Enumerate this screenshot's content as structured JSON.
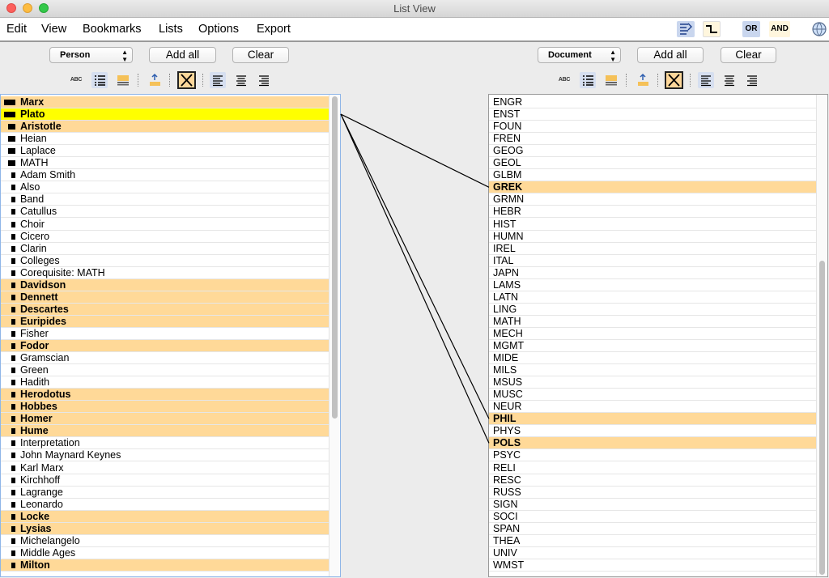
{
  "window": {
    "title": "List View"
  },
  "menu": [
    "Edit",
    "View",
    "Bookmarks",
    "Lists",
    "Options",
    "Export"
  ],
  "toolbar": {
    "or_label": "OR",
    "and_label": "AND",
    "icons": [
      "link-lines-icon",
      "step-icon",
      "or-toggle",
      "and-toggle",
      "globe-icon"
    ]
  },
  "left": {
    "type_select": "Person",
    "add_all": "Add all",
    "clear": "Clear",
    "abc": "ABC",
    "items": [
      {
        "label": "Marx",
        "state": "hl",
        "size": "big"
      },
      {
        "label": "Plato",
        "state": "sel",
        "size": "big"
      },
      {
        "label": "Aristotle",
        "state": "hl",
        "size": "med"
      },
      {
        "label": "Heian",
        "state": "",
        "size": "med"
      },
      {
        "label": "Laplace",
        "state": "",
        "size": "med"
      },
      {
        "label": "MATH",
        "state": "",
        "size": "med"
      },
      {
        "label": "Adam Smith",
        "state": "",
        "size": "small"
      },
      {
        "label": "Also",
        "state": "",
        "size": "small"
      },
      {
        "label": "Band",
        "state": "",
        "size": "small"
      },
      {
        "label": "Catullus",
        "state": "",
        "size": "small"
      },
      {
        "label": "Choir",
        "state": "",
        "size": "small"
      },
      {
        "label": "Cicero",
        "state": "",
        "size": "small"
      },
      {
        "label": "Clarin",
        "state": "",
        "size": "small"
      },
      {
        "label": "Colleges",
        "state": "",
        "size": "small"
      },
      {
        "label": "Corequisite: MATH",
        "state": "",
        "size": "small"
      },
      {
        "label": "Davidson",
        "state": "hl",
        "size": "small"
      },
      {
        "label": "Dennett",
        "state": "hl",
        "size": "small"
      },
      {
        "label": "Descartes",
        "state": "hl",
        "size": "small"
      },
      {
        "label": "Euripides",
        "state": "hl",
        "size": "small"
      },
      {
        "label": "Fisher",
        "state": "",
        "size": "small"
      },
      {
        "label": "Fodor",
        "state": "hl",
        "size": "small"
      },
      {
        "label": "Gramscian",
        "state": "",
        "size": "small"
      },
      {
        "label": "Green",
        "state": "",
        "size": "small"
      },
      {
        "label": "Hadith",
        "state": "",
        "size": "small"
      },
      {
        "label": "Herodotus",
        "state": "hl",
        "size": "small"
      },
      {
        "label": "Hobbes",
        "state": "hl",
        "size": "small"
      },
      {
        "label": "Homer",
        "state": "hl",
        "size": "small"
      },
      {
        "label": "Hume",
        "state": "hl",
        "size": "small"
      },
      {
        "label": "Interpretation",
        "state": "",
        "size": "small"
      },
      {
        "label": "John Maynard Keynes",
        "state": "",
        "size": "small"
      },
      {
        "label": "Karl Marx",
        "state": "",
        "size": "small"
      },
      {
        "label": "Kirchhoff",
        "state": "",
        "size": "small"
      },
      {
        "label": "Lagrange",
        "state": "",
        "size": "small"
      },
      {
        "label": "Leonardo",
        "state": "",
        "size": "small"
      },
      {
        "label": "Locke",
        "state": "hl",
        "size": "small"
      },
      {
        "label": "Lysias",
        "state": "hl",
        "size": "small"
      },
      {
        "label": "Michelangelo",
        "state": "",
        "size": "small"
      },
      {
        "label": "Middle Ages",
        "state": "",
        "size": "small"
      },
      {
        "label": "Milton",
        "state": "hl",
        "size": "small"
      }
    ]
  },
  "right": {
    "type_select": "Document",
    "add_all": "Add all",
    "clear": "Clear",
    "abc": "ABC",
    "items": [
      {
        "label": "ENGR",
        "state": ""
      },
      {
        "label": "ENST",
        "state": ""
      },
      {
        "label": "FOUN",
        "state": ""
      },
      {
        "label": "FREN",
        "state": ""
      },
      {
        "label": "GEOG",
        "state": ""
      },
      {
        "label": "GEOL",
        "state": ""
      },
      {
        "label": "GLBM",
        "state": ""
      },
      {
        "label": "GREK",
        "state": "hl"
      },
      {
        "label": "GRMN",
        "state": ""
      },
      {
        "label": "HEBR",
        "state": ""
      },
      {
        "label": "HIST",
        "state": ""
      },
      {
        "label": "HUMN",
        "state": ""
      },
      {
        "label": "IREL",
        "state": ""
      },
      {
        "label": "ITAL",
        "state": ""
      },
      {
        "label": "JAPN",
        "state": ""
      },
      {
        "label": "LAMS",
        "state": ""
      },
      {
        "label": "LATN",
        "state": ""
      },
      {
        "label": "LING",
        "state": ""
      },
      {
        "label": "MATH",
        "state": ""
      },
      {
        "label": "MECH",
        "state": ""
      },
      {
        "label": "MGMT",
        "state": ""
      },
      {
        "label": "MIDE",
        "state": ""
      },
      {
        "label": "MILS",
        "state": ""
      },
      {
        "label": "MSUS",
        "state": ""
      },
      {
        "label": "MUSC",
        "state": ""
      },
      {
        "label": "NEUR",
        "state": ""
      },
      {
        "label": "PHIL",
        "state": "hl"
      },
      {
        "label": "PHYS",
        "state": ""
      },
      {
        "label": "POLS",
        "state": "hl"
      },
      {
        "label": "PSYC",
        "state": ""
      },
      {
        "label": "RELI",
        "state": ""
      },
      {
        "label": "RESC",
        "state": ""
      },
      {
        "label": "RUSS",
        "state": ""
      },
      {
        "label": "SIGN",
        "state": ""
      },
      {
        "label": "SOCI",
        "state": ""
      },
      {
        "label": "SPAN",
        "state": ""
      },
      {
        "label": "THEA",
        "state": ""
      },
      {
        "label": "UNIV",
        "state": ""
      },
      {
        "label": "WMST",
        "state": ""
      }
    ]
  },
  "links": [
    {
      "from": "Plato",
      "to": "GREK"
    },
    {
      "from": "Plato",
      "to": "PHIL"
    },
    {
      "from": "Plato",
      "to": "POLS"
    }
  ]
}
